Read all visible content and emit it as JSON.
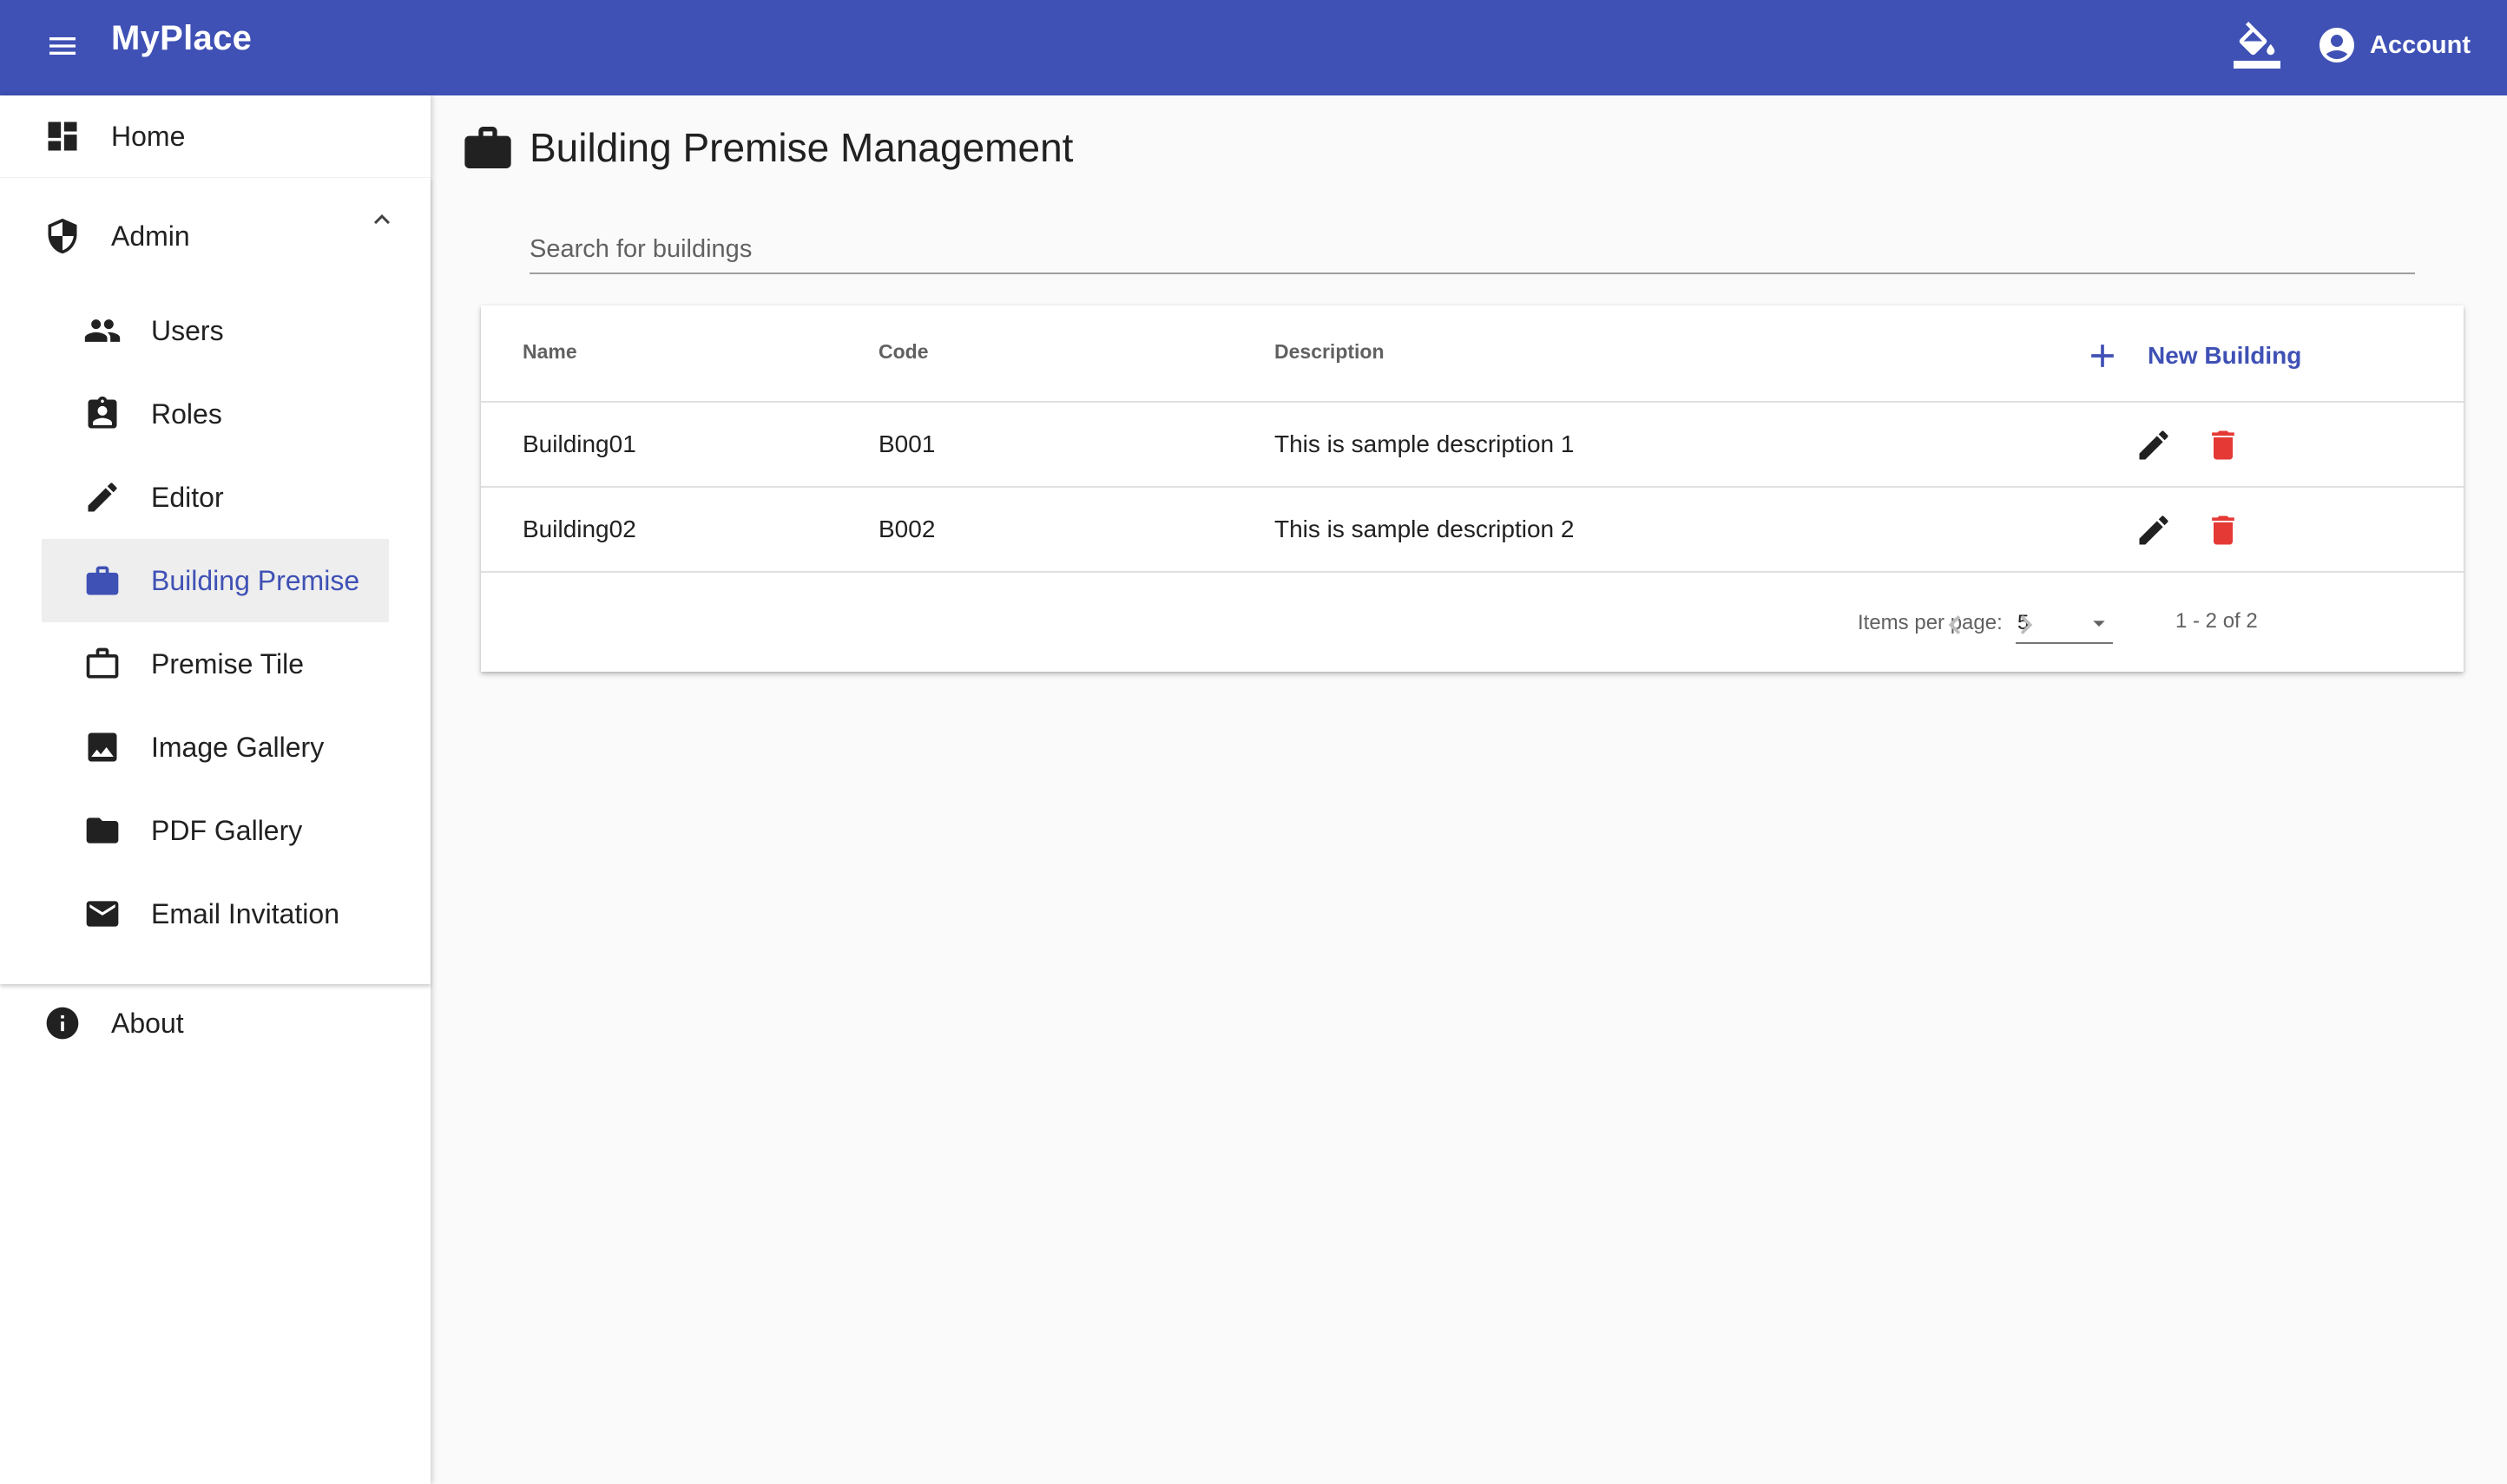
{
  "app": {
    "title": "MyPlace",
    "account_label": "Account"
  },
  "sidebar": {
    "home": {
      "label": "Home",
      "icon": "dashboard-icon"
    },
    "admin": {
      "label": "Admin",
      "icon": "shield-icon",
      "expanded": true
    },
    "admin_items": [
      {
        "label": "Users",
        "icon": "people-icon"
      },
      {
        "label": "Roles",
        "icon": "badge-icon"
      },
      {
        "label": "Editor",
        "icon": "pencil-icon"
      },
      {
        "label": "Building Premise",
        "icon": "briefcase-icon",
        "active": true
      },
      {
        "label": "Premise Tile",
        "icon": "briefcase-outline-icon"
      },
      {
        "label": "Image Gallery",
        "icon": "image-icon"
      },
      {
        "label": "PDF Gallery",
        "icon": "folder-icon"
      },
      {
        "label": "Email Invitation",
        "icon": "mail-icon"
      }
    ],
    "about": {
      "label": "About",
      "icon": "info-icon"
    }
  },
  "page": {
    "title": "Building Premise Management"
  },
  "search": {
    "placeholder": "Search for buildings",
    "value": ""
  },
  "table": {
    "headers": {
      "name": "Name",
      "code": "Code",
      "description": "Description"
    },
    "new_button_label": "New Building",
    "rows": [
      {
        "name": "Building01",
        "code": "B001",
        "description": "This is sample description 1"
      },
      {
        "name": "Building02",
        "code": "B002",
        "description": "This is sample description 2"
      }
    ]
  },
  "paginator": {
    "items_per_page_label": "Items per page:",
    "page_size": "5",
    "range_label": "1 - 2 of 2"
  },
  "colors": {
    "primary": "#3f51b5",
    "delete": "#e53935",
    "background": "#fafafa"
  }
}
